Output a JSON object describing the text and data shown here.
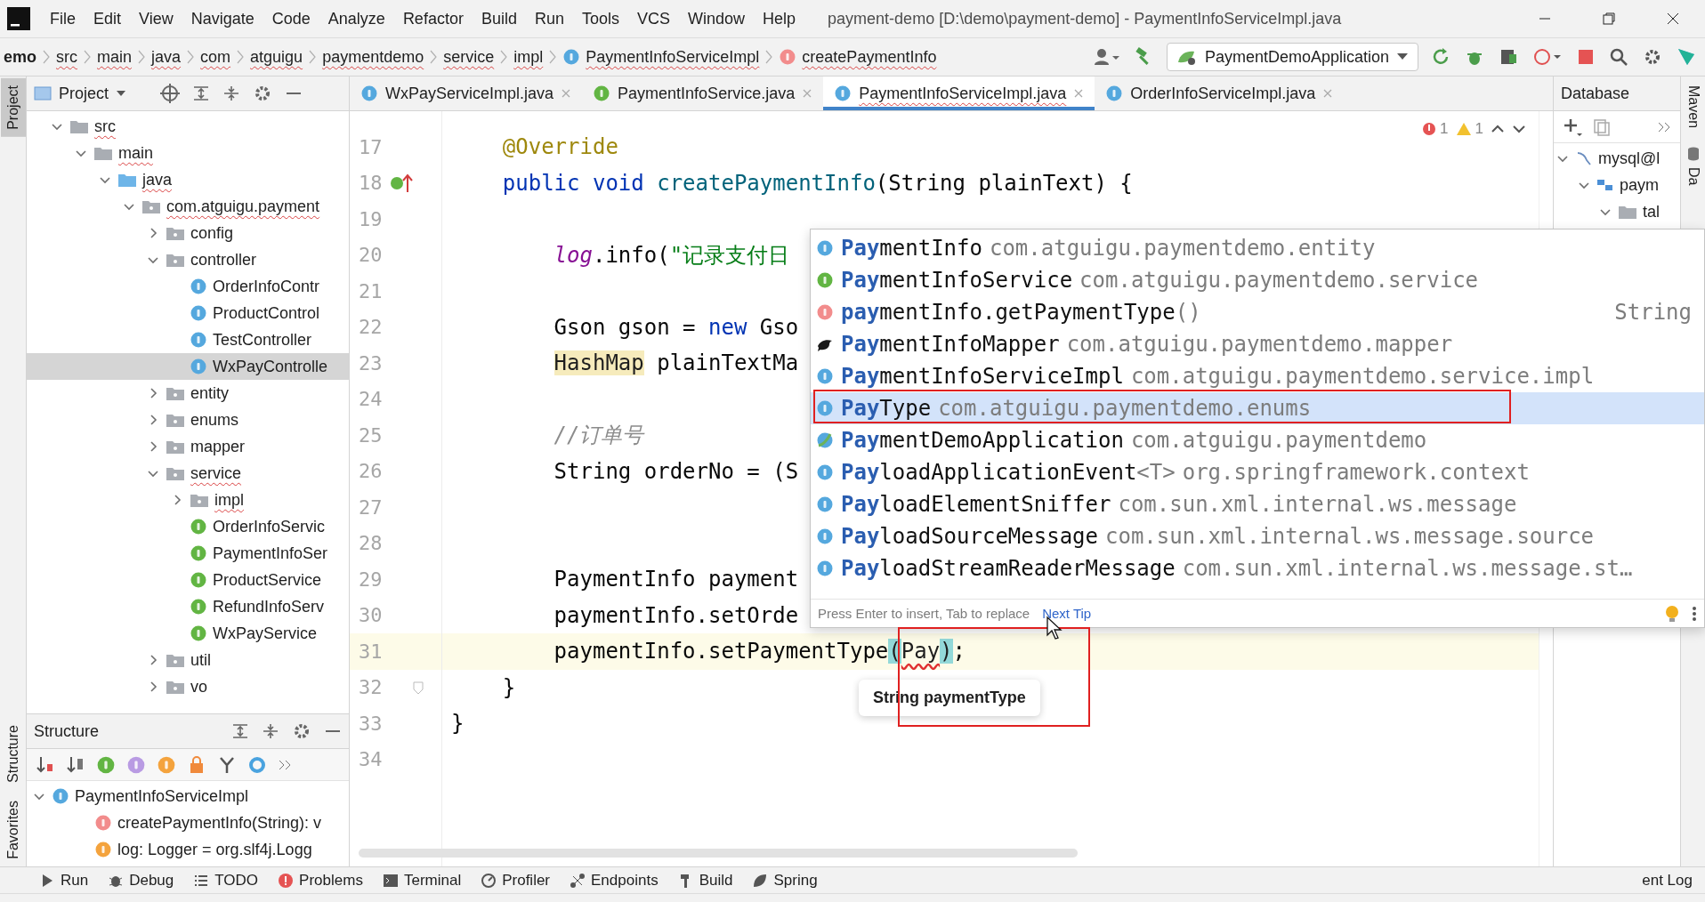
{
  "menu_bar": {
    "items": [
      "File",
      "Edit",
      "View",
      "Navigate",
      "Code",
      "Analyze",
      "Refactor",
      "Build",
      "Run",
      "Tools",
      "VCS",
      "Window",
      "Help"
    ],
    "title": "payment-demo [D:\\demo\\payment-demo] - PaymentInfoServiceImpl.java"
  },
  "breadcrumbs": [
    {
      "label": "emo",
      "kind": "project",
      "underlined": false
    },
    {
      "label": "src",
      "kind": "folder",
      "underlined": true
    },
    {
      "label": "main",
      "kind": "folder",
      "underlined": true
    },
    {
      "label": "java",
      "kind": "folder",
      "underlined": true
    },
    {
      "label": "com",
      "kind": "folder",
      "underlined": true
    },
    {
      "label": "atguigu",
      "kind": "folder",
      "underlined": true
    },
    {
      "label": "paymentdemo",
      "kind": "folder",
      "underlined": true
    },
    {
      "label": "service",
      "kind": "folder",
      "underlined": true
    },
    {
      "label": "impl",
      "kind": "folder",
      "underlined": true
    },
    {
      "label": "PaymentInfoServiceImpl",
      "kind": "class",
      "underlined": true
    },
    {
      "label": "createPaymentInfo",
      "kind": "method",
      "underlined": true
    }
  ],
  "run_config": "PaymentDemoApplication",
  "left_stripe": [
    {
      "label": "Project",
      "selected": true
    },
    {
      "label": "Structure",
      "selected": false
    },
    {
      "label": "Favorites",
      "selected": false
    }
  ],
  "project_panel": {
    "title": "Project",
    "tree": [
      {
        "label": "src",
        "kind": "folder",
        "underlined": true,
        "selected": false,
        "expanded": true,
        "children": [
          {
            "label": "main",
            "kind": "folder",
            "underlined": true,
            "selected": false,
            "expanded": true,
            "children": [
              {
                "label": "java",
                "kind": "source-root",
                "underlined": true,
                "selected": false,
                "expanded": true,
                "children": [
                  {
                    "label": "com.atguigu.payment",
                    "kind": "package",
                    "underlined": true,
                    "selected": false,
                    "expanded": true,
                    "children": [
                      {
                        "label": "config",
                        "kind": "package",
                        "underlined": false,
                        "selected": false,
                        "expanded": false
                      },
                      {
                        "label": "controller",
                        "kind": "package",
                        "underlined": false,
                        "selected": false,
                        "expanded": true,
                        "children": [
                          {
                            "label": "OrderInfoContr",
                            "kind": "class",
                            "underlined": false,
                            "selected": false
                          },
                          {
                            "label": "ProductControl",
                            "kind": "class",
                            "underlined": false,
                            "selected": false
                          },
                          {
                            "label": "TestController",
                            "kind": "class",
                            "underlined": false,
                            "selected": false
                          },
                          {
                            "label": "WxPayControlle",
                            "kind": "class",
                            "underlined": false,
                            "selected": true
                          }
                        ]
                      },
                      {
                        "label": "entity",
                        "kind": "package",
                        "underlined": false,
                        "selected": false,
                        "expanded": false
                      },
                      {
                        "label": "enums",
                        "kind": "package",
                        "underlined": false,
                        "selected": false,
                        "expanded": false
                      },
                      {
                        "label": "mapper",
                        "kind": "package",
                        "underlined": false,
                        "selected": false,
                        "expanded": false
                      },
                      {
                        "label": "service",
                        "kind": "package",
                        "underlined": true,
                        "selected": false,
                        "expanded": true,
                        "children": [
                          {
                            "label": "impl",
                            "kind": "package",
                            "underlined": true,
                            "selected": false,
                            "expanded": false
                          },
                          {
                            "label": "OrderInfoServic",
                            "kind": "interface",
                            "underlined": false,
                            "selected": false
                          },
                          {
                            "label": "PaymentInfoSer",
                            "kind": "interface",
                            "underlined": false,
                            "selected": false
                          },
                          {
                            "label": "ProductService",
                            "kind": "interface",
                            "underlined": false,
                            "selected": false
                          },
                          {
                            "label": "RefundInfoServ",
                            "kind": "interface",
                            "underlined": false,
                            "selected": false
                          },
                          {
                            "label": "WxPayService",
                            "kind": "interface",
                            "underlined": false,
                            "selected": false
                          }
                        ]
                      },
                      {
                        "label": "util",
                        "kind": "package",
                        "underlined": false,
                        "selected": false,
                        "expanded": false
                      },
                      {
                        "label": "vo",
                        "kind": "package",
                        "underlined": false,
                        "selected": false,
                        "expanded": false
                      }
                    ]
                  }
                ]
              }
            ]
          }
        ]
      }
    ]
  },
  "structure_panel": {
    "title": "Structure",
    "tree": [
      {
        "label": "PaymentInfoServiceImpl",
        "kind": "class",
        "expanded": true,
        "children": [
          {
            "label": "createPaymentInfo(String): v",
            "kind": "method"
          },
          {
            "label": "log: Logger = org.slf4j.Logg",
            "kind": "field"
          }
        ]
      }
    ]
  },
  "editor_tabs": [
    {
      "label": "WxPayServiceImpl.java",
      "kind": "class",
      "selected": false
    },
    {
      "label": "PaymentInfoService.java",
      "kind": "interface",
      "selected": false
    },
    {
      "label": "PaymentInfoServiceImpl.java",
      "kind": "class",
      "selected": true
    },
    {
      "label": "OrderInfoServiceImpl.java",
      "kind": "class",
      "selected": false
    }
  ],
  "inspections": {
    "errors": "1",
    "warnings": "1"
  },
  "code_lines": [
    {
      "number": "17",
      "kind": "plain",
      "current": false,
      "segments": [
        {
          "kind": "annotation",
          "text": "    @Override"
        }
      ]
    },
    {
      "number": "18",
      "kind": "override",
      "current": false,
      "segments": [
        {
          "kind": "keyword",
          "text": "    public void "
        },
        {
          "kind": "method",
          "text": "createPaymentInfo"
        },
        {
          "kind": "plain",
          "text": "(String plainText) {"
        }
      ]
    },
    {
      "number": "19",
      "kind": "plain",
      "current": false
    },
    {
      "number": "20",
      "kind": "plain",
      "current": false,
      "segments": [
        {
          "kind": "static",
          "text": "        log"
        },
        {
          "kind": "plain",
          "text": ".info("
        },
        {
          "kind": "string",
          "text": "\"记录支付日"
        }
      ]
    },
    {
      "number": "21",
      "kind": "plain",
      "current": false
    },
    {
      "number": "22",
      "kind": "plain",
      "current": false,
      "segments": [
        {
          "kind": "plain",
          "text": "        Gson gson = "
        },
        {
          "kind": "keyword",
          "text": "new"
        },
        {
          "kind": "plain",
          "text": " Gso"
        }
      ]
    },
    {
      "number": "23",
      "kind": "plain",
      "current": false,
      "segments": [
        {
          "kind": "highlight",
          "text": "        HashMap"
        },
        {
          "kind": "plain",
          "text": " plainTextMa"
        }
      ]
    },
    {
      "number": "24",
      "kind": "plain",
      "current": false
    },
    {
      "number": "25",
      "kind": "plain",
      "current": false,
      "segments": [
        {
          "kind": "comment",
          "text": "        //订单号"
        }
      ]
    },
    {
      "number": "26",
      "kind": "plain",
      "current": false,
      "segments": [
        {
          "kind": "plain",
          "text": "        String orderNo = (S"
        }
      ]
    },
    {
      "number": "27",
      "kind": "plain",
      "current": false
    },
    {
      "number": "28",
      "kind": "plain",
      "current": false
    },
    {
      "number": "29",
      "kind": "plain",
      "current": false,
      "segments": [
        {
          "kind": "plain",
          "text": "        PaymentInfo payment"
        }
      ]
    },
    {
      "number": "30",
      "kind": "plain",
      "current": false,
      "segments": [
        {
          "kind": "plain",
          "text": "        paymentInfo.setOrde"
        }
      ]
    },
    {
      "number": "31",
      "kind": "plain",
      "current": true,
      "segments": [
        {
          "kind": "plain",
          "text": "        paymentInfo.setPaymentType"
        },
        {
          "kind": "brace",
          "text": "("
        },
        {
          "kind": "error",
          "text": "Pay"
        },
        {
          "kind": "brace",
          "text": ")"
        },
        {
          "kind": "plain",
          "text": ";"
        }
      ]
    },
    {
      "number": "32",
      "kind": "fold",
      "current": false,
      "segments": [
        {
          "kind": "plain",
          "text": "    }"
        }
      ]
    },
    {
      "number": "33",
      "kind": "plain",
      "current": false,
      "segments": [
        {
          "kind": "plain",
          "text": "}"
        }
      ]
    },
    {
      "number": "34",
      "kind": "plain",
      "current": false
    }
  ],
  "completion_popup": {
    "items": [
      {
        "kind": "class",
        "match": "Pay",
        "rest": "mentInfo",
        "location": "com.atguigu.paymentdemo.entity",
        "selected": false
      },
      {
        "kind": "interface",
        "match": "Pay",
        "rest": "mentInfoService",
        "location": "com.atguigu.paymentdemo.service",
        "selected": false
      },
      {
        "kind": "method",
        "match": "pay",
        "rest": "mentInfo.getPaymentType",
        "params": "()",
        "type": "String",
        "selected": false
      },
      {
        "kind": "bird",
        "match": "Pay",
        "rest": "mentInfoMapper",
        "location": "com.atguigu.paymentdemo.mapper",
        "selected": false
      },
      {
        "kind": "class",
        "match": "Pay",
        "rest": "mentInfoServiceImpl",
        "location": "com.atguigu.paymentdemo.service.impl",
        "selected": false
      },
      {
        "kind": "enum",
        "match": "Pay",
        "rest": "Type",
        "location": "com.atguigu.paymentdemo.enums",
        "selected": true
      },
      {
        "kind": "app",
        "match": "Pay",
        "rest": "mentDemoApplication",
        "location": "com.atguigu.paymentdemo",
        "selected": false
      },
      {
        "kind": "class",
        "match": "Pay",
        "rest": "loadApplicationEvent",
        "params": "<T>",
        "location": "org.springframework.context",
        "selected": false
      },
      {
        "kind": "class",
        "match": "Pay",
        "rest": "loadElementSniffer",
        "location": "com.sun.xml.internal.ws.message",
        "selected": false
      },
      {
        "kind": "class",
        "match": "Pay",
        "rest": "loadSourceMessage",
        "location": "com.sun.xml.internal.ws.message.source",
        "selected": false
      },
      {
        "kind": "class",
        "match": "Pay",
        "rest": "loadStreamReaderMessage",
        "location": "com.sun.xml.internal.ws.message.st…",
        "selected": false
      }
    ],
    "hint": "Press Enter to insert, Tab to replace",
    "link": "Next Tip"
  },
  "parameter_hint": "String paymentType",
  "database_panel": {
    "title": "Database",
    "tree": [
      {
        "label": "mysql@l",
        "kind": "datasource",
        "expanded": true,
        "children": [
          {
            "label": "paym",
            "kind": "schema",
            "expanded": true,
            "children": [
              {
                "label": "tal",
                "kind": "folder",
                "expanded": true
              }
            ]
          }
        ]
      }
    ]
  },
  "right_stripe": [
    {
      "label": "Maven",
      "kind": "text"
    },
    {
      "label": "Da",
      "kind": "database"
    }
  ],
  "tool_windows": [
    {
      "label": "Run",
      "kind": "run"
    },
    {
      "label": "Debug",
      "kind": "bug"
    },
    {
      "label": "TODO",
      "kind": "list"
    },
    {
      "label": "Problems",
      "kind": "problems"
    },
    {
      "label": "Terminal",
      "kind": "terminal"
    },
    {
      "label": "Profiler",
      "kind": "profiler"
    },
    {
      "label": "Endpoints",
      "kind": "endpoints"
    },
    {
      "label": "Build",
      "kind": "hammer"
    },
    {
      "label": "Spring",
      "kind": "leaf"
    },
    {
      "label": "ent Log",
      "kind": "text"
    }
  ]
}
